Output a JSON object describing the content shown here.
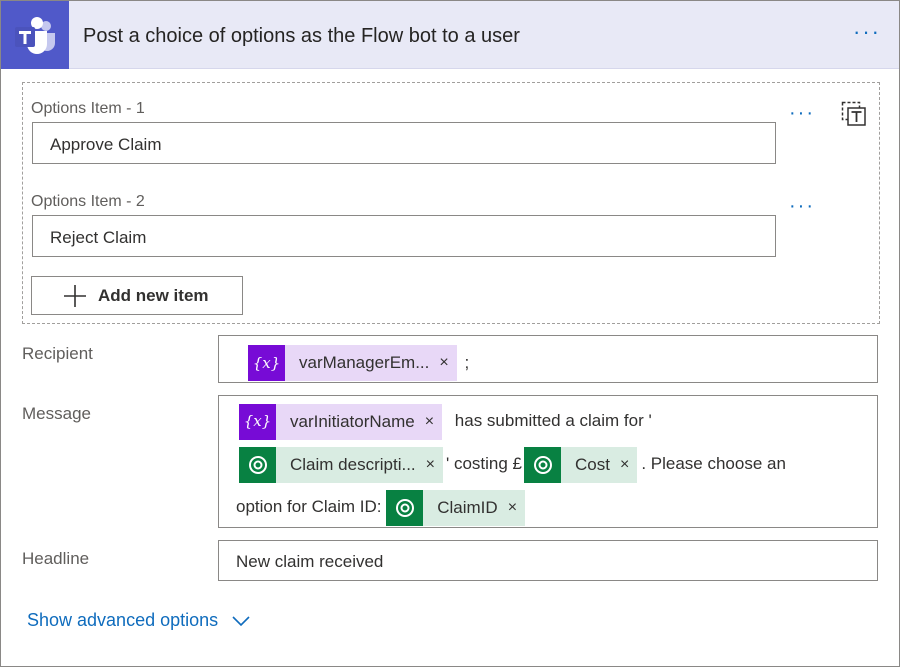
{
  "header": {
    "title": "Post a choice of options as the Flow bot to a user",
    "more": "···",
    "accent": "#5059c9"
  },
  "options": {
    "items": [
      {
        "label": "Options Item - 1",
        "value": "Approve Claim"
      },
      {
        "label": "Options Item - 2",
        "value": "Reject Claim"
      }
    ],
    "more": "···",
    "add_label": "Add new item"
  },
  "recipient": {
    "label": "Recipient",
    "token": "varManagerEm...",
    "suffix": ";"
  },
  "message": {
    "label": "Message",
    "tokens": [
      "varInitiatorName",
      "Claim descripti...",
      "Cost",
      "ClaimID"
    ],
    "text": [
      "has submitted a claim for '",
      "' costing £",
      ". Please choose an",
      "option for Claim ID:"
    ]
  },
  "headline": {
    "label": "Headline",
    "value": "New claim received"
  },
  "advanced": {
    "label": "Show advanced options"
  },
  "token_close": "×",
  "variable_icon": "{x}",
  "colors": {
    "variable_token": "#770bd6",
    "dataverse_token": "#088142",
    "link": "#0f6cbd"
  }
}
